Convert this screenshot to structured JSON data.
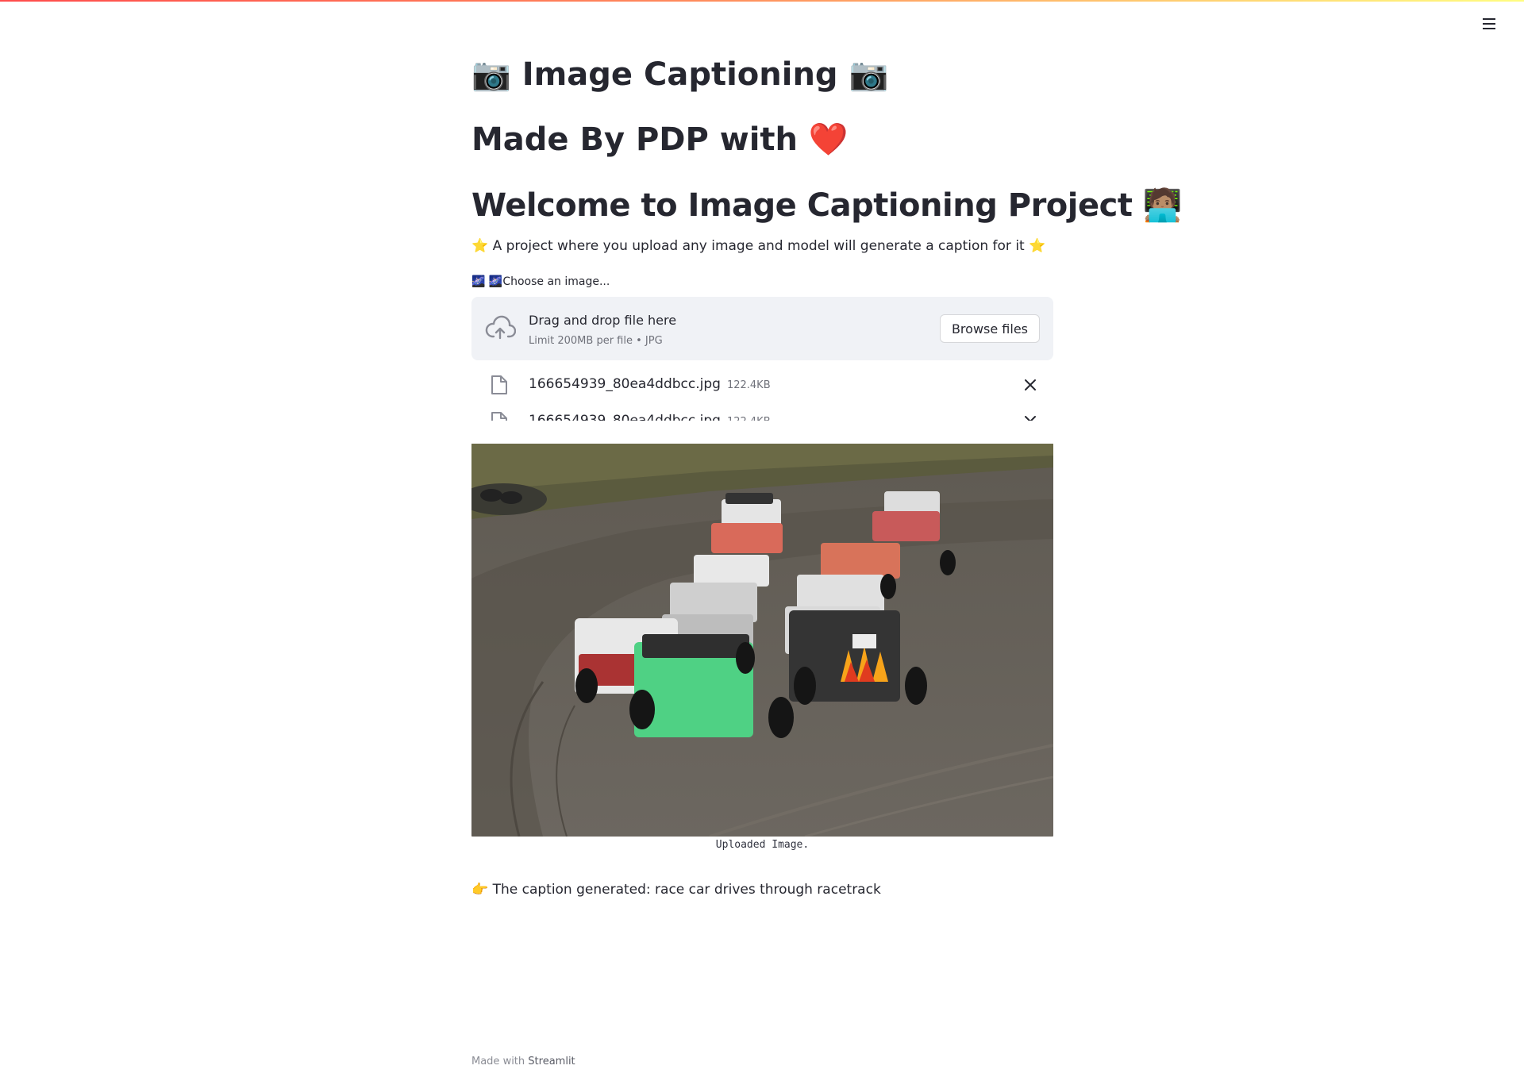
{
  "app": {
    "title": "📷 Image Captioning 📷",
    "subtitle": "Made By PDP with ❤️",
    "welcome": "Welcome to Image Captioning Project 🧑🏽‍💻",
    "description": "⭐ A project where you upload any image and model will generate a caption for it ⭐"
  },
  "uploader": {
    "label": "🌌 🌌Choose an image...",
    "drag_text": "Drag and drop file here",
    "limit_text": "Limit 200MB per file • JPG",
    "browse_label": "Browse files",
    "files": [
      {
        "name": "166654939_80ea4ddbcc.jpg",
        "size": "122.4KB"
      }
    ]
  },
  "image": {
    "caption": "Uploaded Image."
  },
  "result": {
    "text": "👉 The caption generated: race car drives through racetrack"
  },
  "footer": {
    "prefix": "Made with",
    "brand": "Streamlit"
  },
  "colors": {
    "accent_gradient": [
      "#ff4b4b",
      "#fffd80"
    ],
    "dropzone_bg": "#f0f2f6",
    "text": "#262730"
  }
}
